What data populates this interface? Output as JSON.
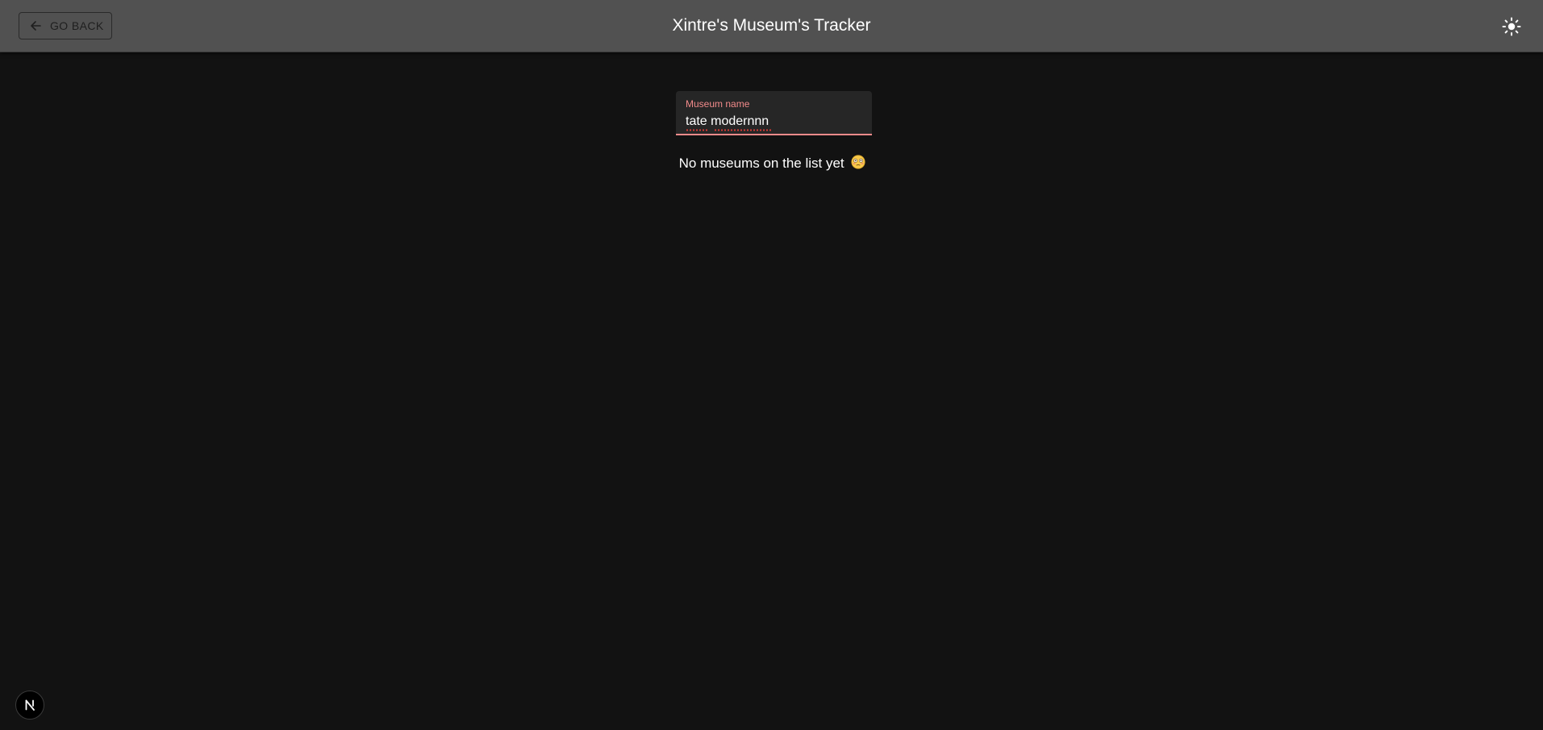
{
  "header": {
    "back_label": "GO BACK",
    "title": "Xintre's Museum's Tracker",
    "theme_toggle_icon": "sun-icon"
  },
  "search": {
    "label": "Museum name",
    "value": "tate modernnn",
    "accent_color": "#f28b8b"
  },
  "list": {
    "empty_message": "No museums on the list yet",
    "empty_emoji": "flushed-face-emoji"
  },
  "dev_badge": {
    "letter": "N",
    "icon": "nextjs-icon"
  }
}
